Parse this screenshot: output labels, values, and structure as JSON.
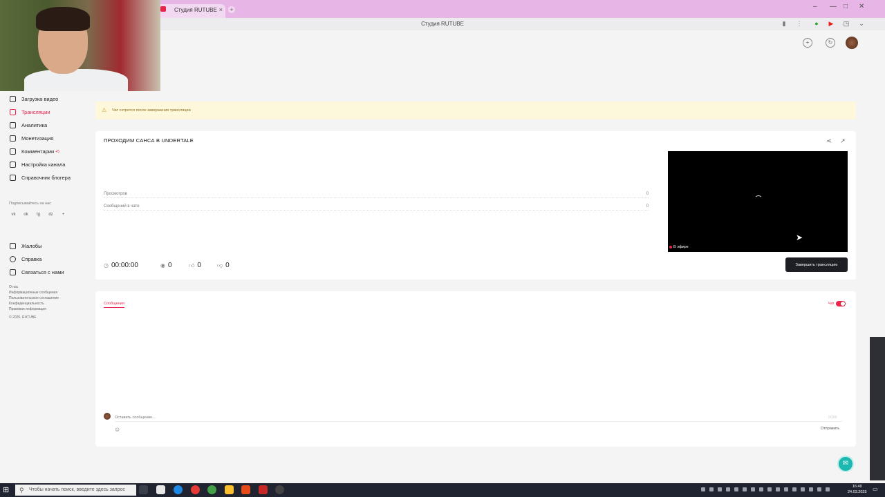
{
  "browser": {
    "tab_title": "Студия RUTUBE",
    "address_title": "Студия RUTUBE",
    "new_tab": "+",
    "close_tab": "×"
  },
  "sidebar": {
    "items": [
      {
        "label": "Загрузка видео"
      },
      {
        "label": "Трансляции"
      },
      {
        "label": "Аналитика"
      },
      {
        "label": "Монетизация"
      },
      {
        "label": "Комментарии"
      },
      {
        "label": "Настройка канала"
      },
      {
        "label": "Справочник блогера"
      }
    ],
    "comments_badge": "+5",
    "subscribe_title": "Подписывайтесь на нас",
    "socials": [
      "vk",
      "ok",
      "tg",
      "dz",
      "+"
    ],
    "help_items": [
      {
        "label": "Жалобы"
      },
      {
        "label": "Справка"
      },
      {
        "label": "Связаться с нами"
      }
    ],
    "footer_links": [
      "О нас",
      "Информационные сообщения",
      "Пользовательское соглашение",
      "Конфиденциальность",
      "Правовая информация",
      "© 2025, RUTUBE"
    ]
  },
  "warning": {
    "text": "Чат сотрется после завершения трансляции"
  },
  "stream": {
    "title": "ПРОХОДИМ САНСА В UNDERTALE",
    "stats": [
      {
        "label": "Просмотров",
        "value": "0"
      },
      {
        "label": "Сообщений в чате",
        "value": "0"
      }
    ],
    "live_label": "В эфире",
    "end_button": "Завершить трансляцию",
    "duration": "00:00:00",
    "viewers": "0",
    "likes": "0",
    "dislikes": "0"
  },
  "chat": {
    "tab_label": "Сообщения",
    "toggle_label": "Чат",
    "input_placeholder": "Оставить сообщение...",
    "counter": "0/200",
    "send_label": "Отправить"
  },
  "taskbar": {
    "search_placeholder": "Чтобы начать поиск, введите здесь запрос",
    "time": "16:40",
    "date": "24.03.2025"
  },
  "colors": {
    "accent": "#e8244a",
    "tabbar": "#e7b6e6",
    "end_button_bg": "#1d1f24",
    "warning_bg": "#fdf7dc"
  },
  "icons": {
    "upload": "upload-icon",
    "broadcast": "broadcast-icon",
    "analytics": "chart-icon",
    "money": "money-icon",
    "comments": "comment-icon",
    "settings": "gear-icon",
    "guide": "book-icon",
    "share": "share-icon",
    "external": "external-link-icon",
    "clock": "clock-icon",
    "eye": "eye-icon",
    "like": "thumbs-up-icon",
    "dislike": "thumbs-down-icon",
    "emoji": "smile-icon",
    "support": "chat-bubble-icon"
  }
}
